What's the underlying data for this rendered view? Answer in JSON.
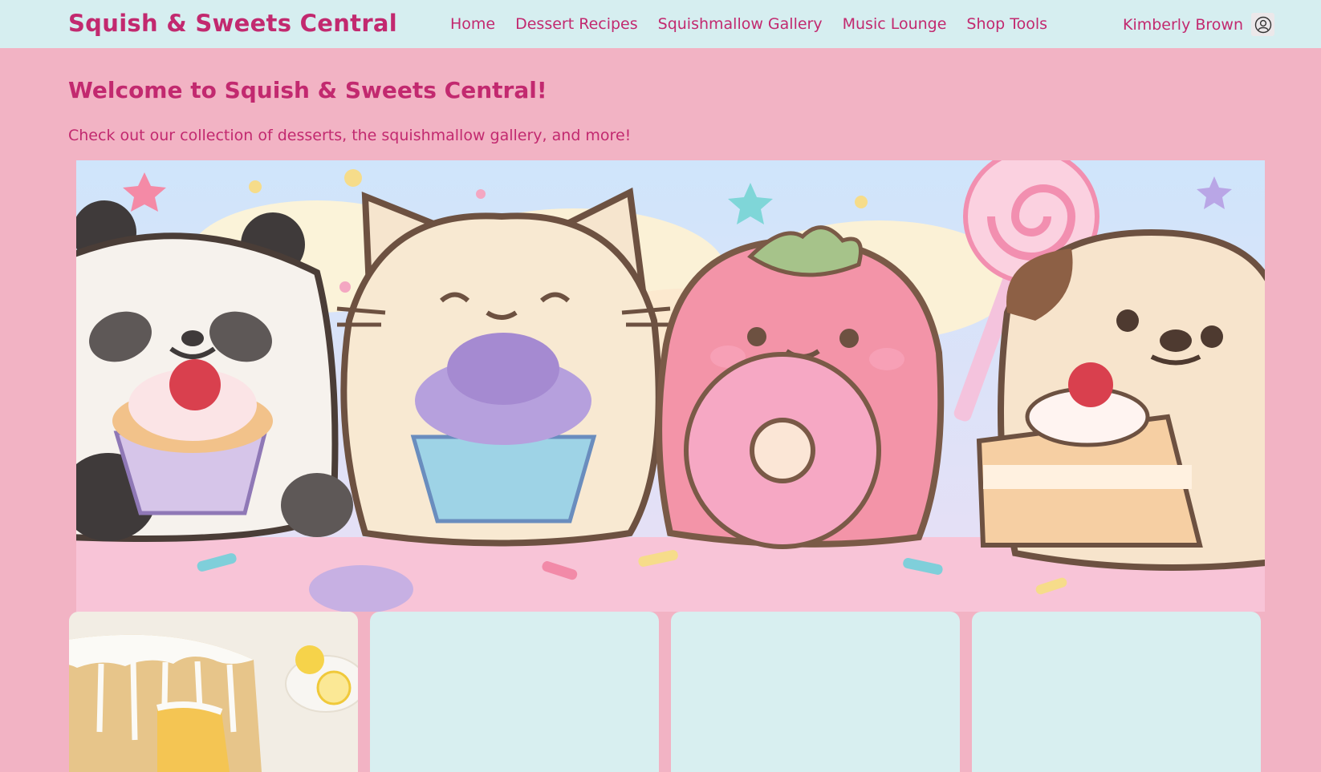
{
  "header": {
    "site_title": "Squish & Sweets Central",
    "nav": [
      {
        "label": "Home"
      },
      {
        "label": "Dessert Recipes"
      },
      {
        "label": "Squishmallow Gallery"
      },
      {
        "label": "Music Lounge"
      },
      {
        "label": "Shop Tools"
      }
    ],
    "user_name": "Kimberly Brown",
    "user_icon": "user-circle-icon"
  },
  "hero": {
    "title": "Welcome to Squish & Sweets Central!",
    "subtitle": "Check out our collection of desserts, the squishmallow gallery, and more!",
    "banner_image": "squishmallows-with-desserts"
  },
  "cards": [
    {
      "image": "lemon-bundt-cake"
    },
    {
      "image": ""
    },
    {
      "image": ""
    },
    {
      "image": ""
    }
  ],
  "colors": {
    "accent": "#c2296f",
    "page_bg": "#f2b3c4",
    "header_bg": "#d6eef0",
    "card_bg": "#d8eff0"
  }
}
